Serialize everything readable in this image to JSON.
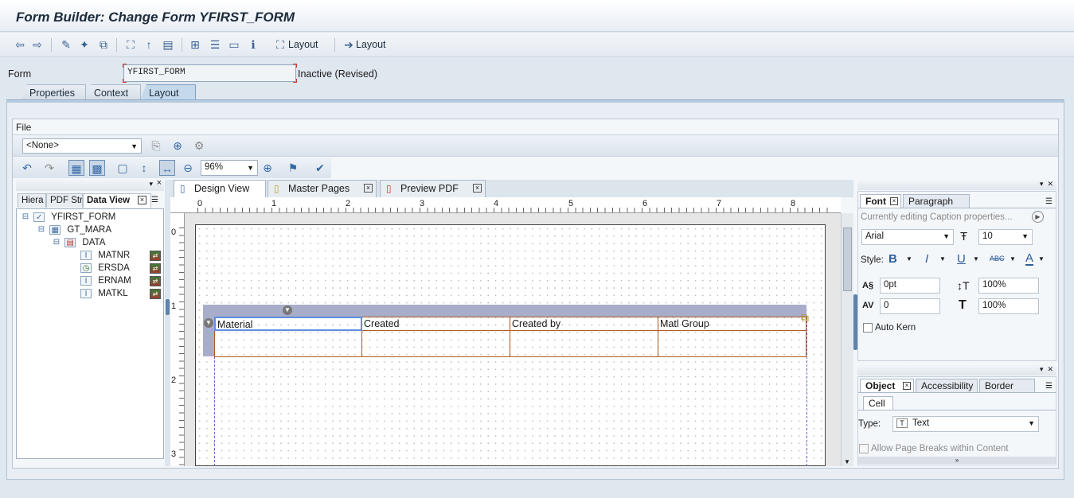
{
  "window": {
    "title": "Form Builder: Change Form YFIRST_FORM"
  },
  "toolbar": {
    "layout1": "Layout",
    "layout2": "Layout"
  },
  "form": {
    "label": "Form",
    "value": "YFIRST_FORM",
    "status": "Inactive (Revised)"
  },
  "main_tabs": [
    "Properties",
    "Context",
    "Layout"
  ],
  "layout": {
    "menu_file": "File",
    "master_select": "<None>",
    "zoom": "96%"
  },
  "left_panel": {
    "tabs": [
      "Hiera",
      "PDF Str",
      "Data View"
    ],
    "tree": [
      "YFIRST_FORM",
      "GT_MARA",
      "DATA",
      "MATNR",
      "ERSDA",
      "ERNAM",
      "MATKL"
    ]
  },
  "design_tabs": [
    "Design View",
    "Master Pages",
    "Preview PDF"
  ],
  "ruler": {
    "h": [
      "0",
      "1",
      "2",
      "3",
      "4",
      "5",
      "6",
      "7",
      "8"
    ],
    "v": [
      "0",
      "1",
      "2",
      "3"
    ]
  },
  "table": {
    "headers": [
      "Material",
      "Created",
      "Created by",
      "Matl Group"
    ]
  },
  "font_panel": {
    "tabs": [
      "Font",
      "Paragraph"
    ],
    "caption_info": "Currently editing Caption properties...",
    "font_name": "Arial",
    "font_size": "10",
    "style_label": "Style:",
    "baseline_shift": "0pt",
    "kerning": "0",
    "vscale": "100%",
    "hscale": "100%",
    "auto_kern": "Auto Kern"
  },
  "object_panel": {
    "tabs": [
      "Object",
      "Accessibility",
      "Border"
    ],
    "sub_tab": "Cell",
    "type_label": "Type:",
    "type_value": "Text",
    "allow_breaks": "Allow Page Breaks within Content"
  }
}
